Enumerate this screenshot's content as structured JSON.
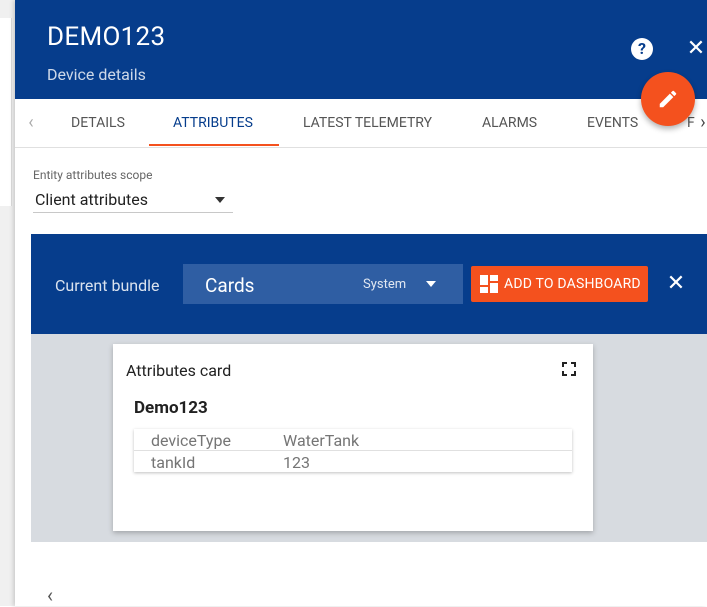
{
  "header": {
    "title": "DEMO123",
    "subtitle": "Device details",
    "help_glyph": "?",
    "close_glyph": "✕"
  },
  "tabs": [
    {
      "label": "DETAILS"
    },
    {
      "label": "ATTRIBUTES"
    },
    {
      "label": "LATEST TELEMETRY"
    },
    {
      "label": "ALARMS"
    },
    {
      "label": "EVENTS"
    },
    {
      "label": "F"
    }
  ],
  "active_tab": "ATTRIBUTES",
  "scope": {
    "label": "Entity attributes scope",
    "value": "Client attributes"
  },
  "bundle": {
    "label": "Current bundle",
    "name": "Cards",
    "tag": "System",
    "add_button": "ADD TO DASHBOARD",
    "close_glyph": "✕"
  },
  "card": {
    "title": "Attributes card",
    "entity": "Demo123",
    "rows": [
      {
        "key": "deviceType",
        "value": "WaterTank"
      },
      {
        "key": "tankId",
        "value": "123"
      }
    ]
  },
  "icons": {
    "help": "help-icon",
    "close": "close-icon",
    "edit": "edit-pencil-icon",
    "fullscreen": "fullscreen-icon",
    "dashboard": "dashboard-icon",
    "prev": "chevron-left-icon",
    "next": "chevron-right-icon"
  },
  "colors": {
    "primary": "#063d8c",
    "accent": "#f4511e",
    "bundle_select": "#2f5ea3",
    "grid_bg": "#d7dbe0"
  }
}
